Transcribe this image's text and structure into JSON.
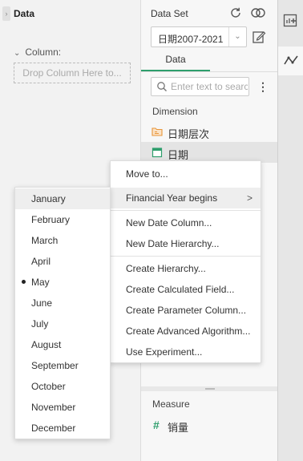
{
  "left_panel": {
    "title": "Data",
    "column_label": "Column:",
    "drop_zone": "Drop Column Here to..."
  },
  "dataset": {
    "label": "Data Set",
    "selected": "日期2007-2021",
    "tab": "Data",
    "search_placeholder": "Enter text to search",
    "dimension_label": "Dimension",
    "dimensions": [
      {
        "label": "日期层次",
        "icon": "hierarchy-folder-icon"
      },
      {
        "label": "日期",
        "icon": "date-calendar-icon"
      }
    ],
    "measure_label": "Measure",
    "measures": [
      {
        "label": "销量",
        "icon": "hash-icon"
      }
    ]
  },
  "context_menu": {
    "items": [
      {
        "label": "Move to..."
      },
      {
        "label": "Financial Year begins",
        "submenu": true
      },
      {
        "label": "New Date Column..."
      },
      {
        "label": "New Date Hierarchy..."
      },
      {
        "label": "Create Hierarchy..."
      },
      {
        "label": "Create Calculated Field..."
      },
      {
        "label": "Create Parameter Column..."
      },
      {
        "label": "Create Advanced Algorithm..."
      },
      {
        "label": "Use Experiment..."
      }
    ],
    "submenu_arrow": ">"
  },
  "month_menu": {
    "selected": "May",
    "items": [
      "January",
      "February",
      "March",
      "April",
      "May",
      "June",
      "July",
      "August",
      "September",
      "October",
      "November",
      "December"
    ]
  },
  "colors": {
    "accent": "#2e9e6c",
    "folder": "#e8963a"
  }
}
